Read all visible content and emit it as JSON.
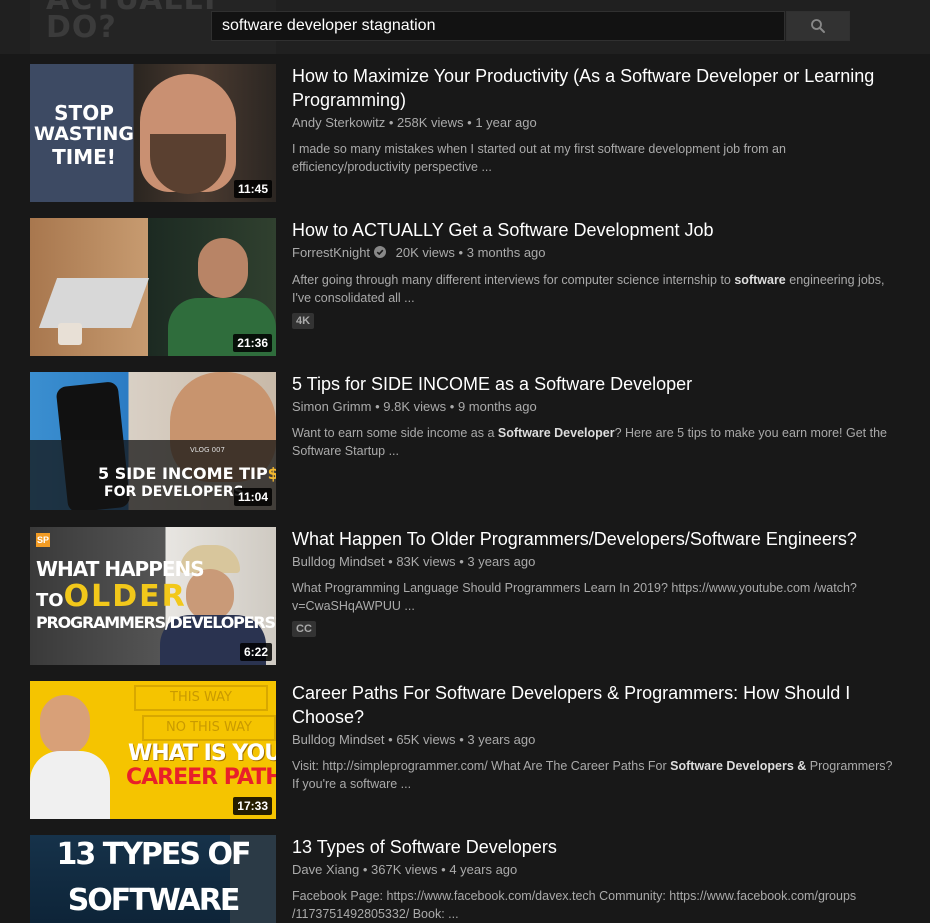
{
  "search": {
    "query": "software developer stagnation",
    "bg_thumb_text": "ACTUALLY\nDO?"
  },
  "results": [
    {
      "title": "How to Maximize Your Productivity (As a Software Developer or Learning Programming)",
      "channel": "Andy Sterkowitz",
      "views": "258K views",
      "age": "1 year ago",
      "desc": "I made so many mistakes when I started out at my first software development job from an efficiency/productivity perspective ...",
      "duration": "11:45",
      "thumb_text": [
        "STOP",
        "WASTING",
        "TIME!"
      ]
    },
    {
      "title": "How to ACTUALLY Get a Software Development Job",
      "channel": "ForrestKnight",
      "views": "20K views",
      "age": "3 months ago",
      "desc_pre": "After going through many different interviews for computer science internship to ",
      "desc_bold": "software",
      "desc_post": " engineering jobs, I've consolidated all ...",
      "badge": "4K",
      "duration": "21:36"
    },
    {
      "title": "5 Tips for SIDE INCOME as a Software Developer",
      "channel": "Simon Grimm",
      "views": "9.8K views",
      "age": "9 months ago",
      "desc_pre": "Want to earn some side income as a ",
      "desc_bold": "Software Developer",
      "desc_post": "? Here are 5 tips to make you earn more! Get the Software Startup ...",
      "duration": "11:04",
      "thumb_vlog": "VLOG 007",
      "thumb_line1": "5 SIDE INCOME TIP",
      "thumb_dollar": "$",
      "thumb_line2": "FOR DEVELOPERS"
    },
    {
      "title": "What Happen To Older Programmers/Developers/Software Engineers?",
      "channel": "Bulldog Mindset",
      "views": "83K views",
      "age": "3 years ago",
      "desc": "What Programming Language Should Programmers Learn In 2019? https://www.youtube.com /watch?v=CwaSHqAWPUU ...",
      "badge": "CC",
      "duration": "6:22",
      "thumb_logo": "SP",
      "thumb_line1": "WHAT HAPPENS",
      "thumb_to": "TO",
      "thumb_older": "OLDER",
      "thumb_line3": "PROGRAMMERS/DEVELOPERS?"
    },
    {
      "title": "Career Paths For Software Developers & Programmers: How Should I Choose?",
      "channel": "Bulldog Mindset",
      "views": "65K views",
      "age": "3 years ago",
      "desc_pre": "Visit: http://simpleprogrammer.com/ What Are The Career Paths For ",
      "desc_bold": "Software Developers &",
      "desc_post": " Programmers? If you're a software ...",
      "duration": "17:33",
      "thumb_sign1": "THIS WAY",
      "thumb_sign2": "NO THIS WAY",
      "thumb_line1": "WHAT IS YOUR",
      "thumb_line2": "CAREER PATH?"
    },
    {
      "title": "13 Types of Software Developers",
      "channel": "Dave Xiang",
      "views": "367K views",
      "age": "4 years ago",
      "desc": "Facebook Page: https://www.facebook.com/davex.tech Community: https://www.facebook.com/groups /1173751492805332/ Book: ...",
      "thumb_line1": "13 TYPES OF",
      "thumb_line2": "SOFTWARE"
    }
  ],
  "meta_separator": "•",
  "colors": {
    "background": "#181818",
    "topbar": "#202020",
    "meta_text": "#aaaaaa",
    "career_yellow": "#f5c400",
    "career_red": "#e8202a",
    "older_yellow": "#f2c81a"
  }
}
